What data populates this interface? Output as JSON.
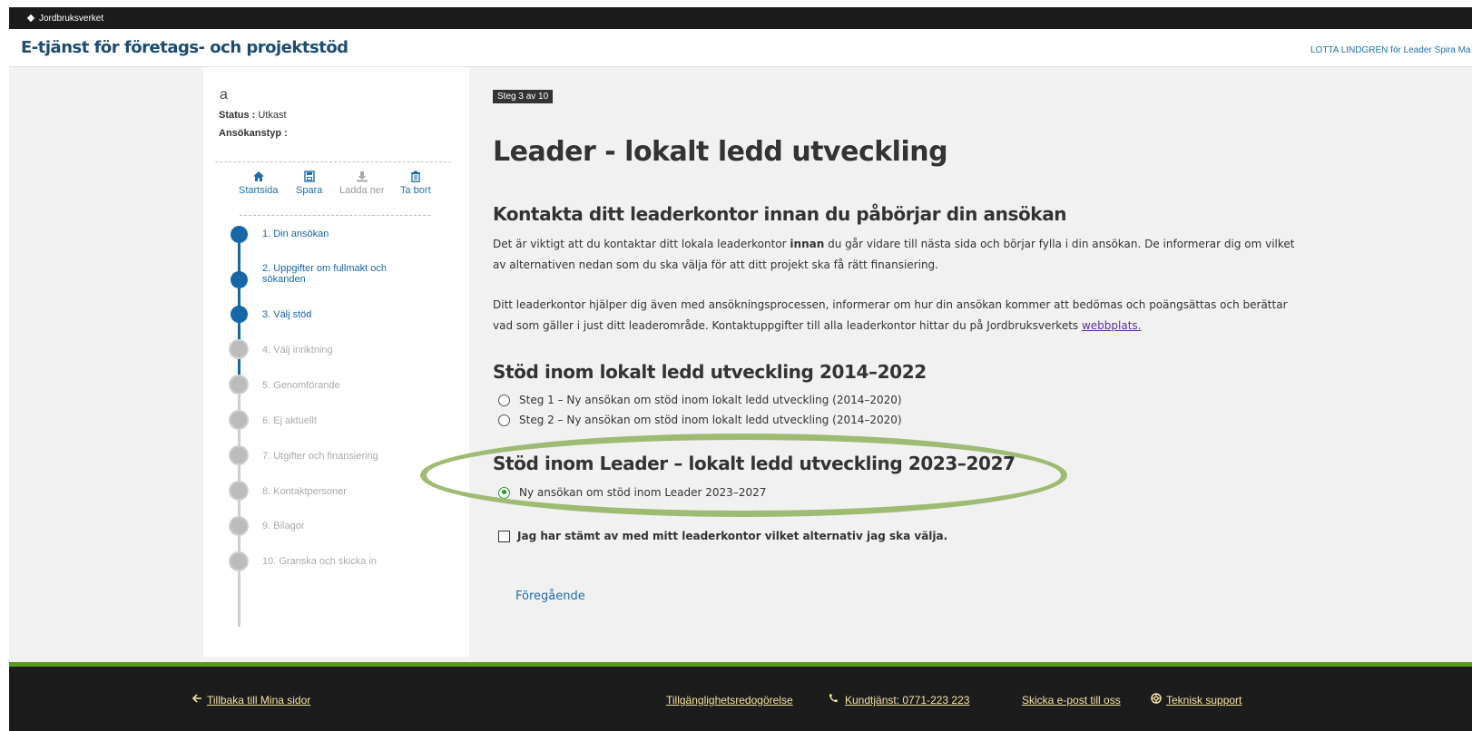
{
  "topbar": {
    "logo_text": "Jordbruksverket"
  },
  "header": {
    "app_title": "E-tjänst för företags- och projektstöd",
    "user_info": "LOTTA LINDGREN för Leader Spira Ma"
  },
  "sidebar": {
    "application_name": "a",
    "status_label": "Status :",
    "status_value": "Utkast",
    "type_label": "Ansökanstyp :",
    "type_value": "",
    "tools": [
      {
        "label": "Startsida",
        "icon": "home-icon",
        "enabled": true
      },
      {
        "label": "Spara",
        "icon": "save-icon",
        "enabled": true
      },
      {
        "label": "Ladda ner",
        "icon": "download-icon",
        "enabled": false
      },
      {
        "label": "Ta bort",
        "icon": "trash-icon",
        "enabled": true
      }
    ],
    "steps": [
      {
        "label": "1. Din ansökan",
        "done": true
      },
      {
        "label": "2. Uppgifter om fullmakt och sökanden",
        "done": true
      },
      {
        "label": "3. Välj stöd",
        "done": true
      },
      {
        "label": "4. Välj inriktning",
        "done": false
      },
      {
        "label": "5. Genomförande",
        "done": false
      },
      {
        "label": "6. Ej aktuellt",
        "done": false
      },
      {
        "label": "7. Utgifter och finansiering",
        "done": false
      },
      {
        "label": "8. Kontaktpersoner",
        "done": false
      },
      {
        "label": "9. Bilagor",
        "done": false
      },
      {
        "label": "10. Granska och skicka in",
        "done": false
      }
    ]
  },
  "content": {
    "step_badge": "Steg 3 av 10",
    "page_title": "Leader - lokalt ledd utveckling",
    "contact_heading": "Kontakta ditt leaderkontor innan du påbörjar din ansökan",
    "para1_pre": "Det är viktigt att du kontaktar ditt lokala leaderkontor ",
    "para1_bold": "innan",
    "para1_post": " du går vidare till nästa sida och börjar fylla i din ansökan. De informerar dig om vilket av alternativen nedan som du ska välja för att ditt projekt ska få rätt finansiering.",
    "para2_pre": "Ditt leaderkontor hjälper dig även med ansökningsprocessen, informerar om hur din ansökan kommer att bedömas och poängsättas och berättar vad som gäller i just ditt leaderområde. Kontaktuppgifter till alla leaderkontor hittar du på Jordbruksverkets ",
    "para2_link": "webbplats.",
    "section1_heading": "Stöd inom lokalt ledd utveckling 2014–2022",
    "option1": "Steg 1 – Ny ansökan om stöd inom lokalt ledd utveckling (2014–2020)",
    "option2": "Steg 2 – Ny ansökan om stöd inom lokalt ledd utveckling (2014–2020)",
    "section2_heading": "Stöd inom Leader – lokalt ledd utveckling 2023–2027",
    "option3": "Ny ansökan om stöd inom Leader 2023–2027",
    "confirm_label": "Jag har stämt av med mitt leaderkontor vilket alternativ jag ska välja.",
    "prev_label": "Föregående"
  },
  "footer": {
    "back_label": "Tillbaka till Mina sidor",
    "accessibility_label": "Tillgänglighetsredogörelse",
    "phone_label": "Kundtjänst: 0771-223 223",
    "email_label": "Skicka e-post till oss",
    "support_label": "Teknisk support"
  },
  "colors": {
    "brand_dark": "#1e4c6f",
    "step_done": "#1567a5",
    "highlight": "#9fba72",
    "footer_accent": "#5b9b1c",
    "footer_link": "#f3e3a0"
  }
}
